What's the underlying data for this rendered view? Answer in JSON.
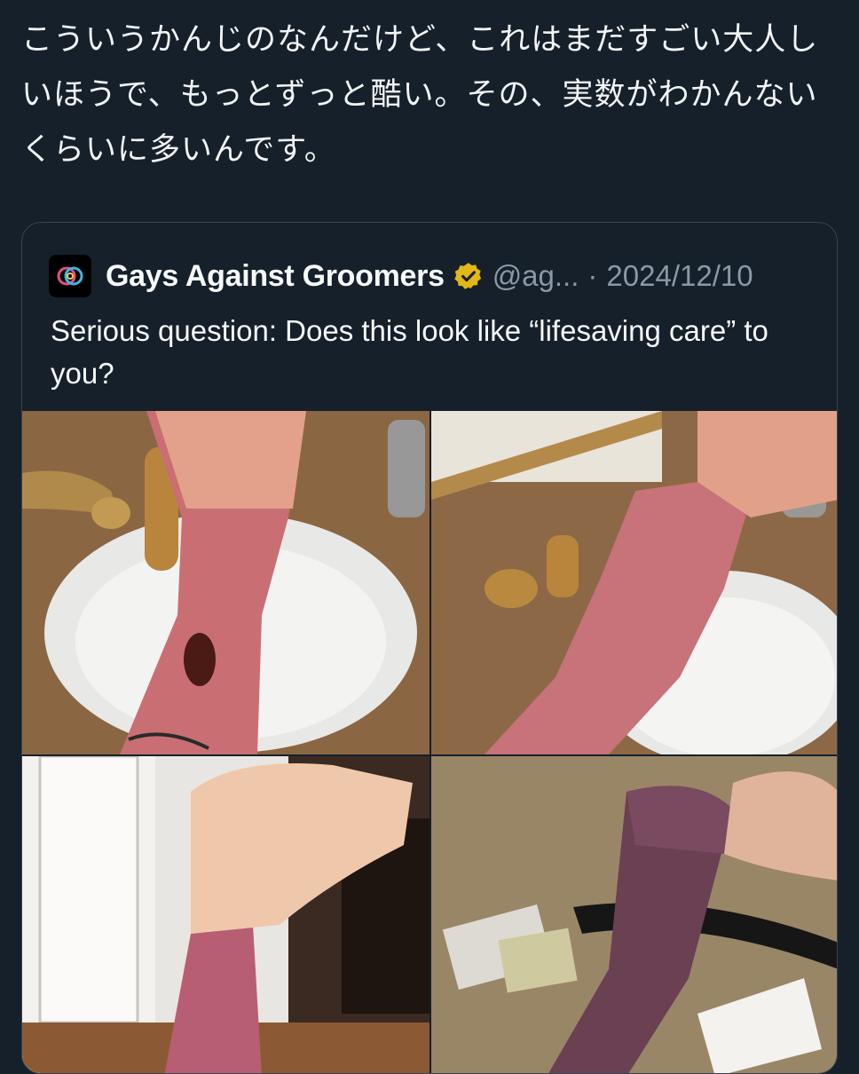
{
  "post": {
    "text": "こういうかんじのなんだけど、これはまだすごい大人しいほうで、もっとずっと酷い。その、実数がわかんないくらいに多いんです。"
  },
  "quoted_post": {
    "author_name": "Gays Against Groomers",
    "handle": "@ag...",
    "separator": "·",
    "date": "2024/12/10",
    "verified": true,
    "text": "Serious question: Does this look like “lifesaving care” to you?",
    "photos": [
      {
        "subject": "scarred forearm over bathroom sink"
      },
      {
        "subject": "scarred forearm over bathroom sink"
      },
      {
        "subject": "scarred forearm near doorway"
      },
      {
        "subject": "discolored forearm over countertop"
      }
    ]
  },
  "colors": {
    "background": "#15202b",
    "border": "#38444d",
    "secondary_text": "#8b98a5",
    "verified_gold": "#e2b719"
  }
}
